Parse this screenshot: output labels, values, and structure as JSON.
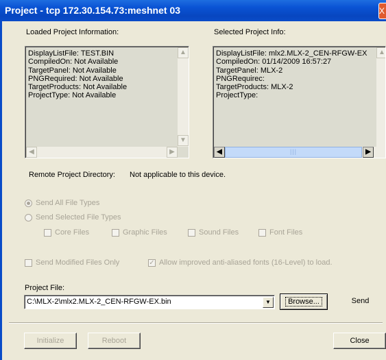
{
  "window": {
    "title": "Project - tcp 172.30.154.73:meshnet 03",
    "close_glyph": "X"
  },
  "loaded": {
    "label": "Loaded Project Information:",
    "lines": [
      "DisplayListFile: TEST.BIN",
      "CompiledOn: Not Available",
      "TargetPanel: Not Available",
      "PNGRequired: Not Available",
      "TargetProducts: Not Available",
      "ProjectType: Not Available"
    ]
  },
  "selected": {
    "label": "Selected Project Info:",
    "lines": [
      "DisplayListFile: mlx2.MLX-2_CEN-RFGW-EX",
      "CompiledOn: 01/14/2009 16:57:27",
      "TargetPanel: MLX-2",
      "PNGRequirec:",
      "TargetProducts: MLX-2",
      "ProjectType:"
    ]
  },
  "remote": {
    "label": "Remote Project Directory:",
    "value": "Not applicable to this device."
  },
  "options": {
    "send_all": "Send All File Types",
    "send_selected": "Send Selected File Types",
    "core": "Core Files",
    "graphic": "Graphic Files",
    "sound": "Sound Files",
    "font": "Font Files",
    "modified_only": "Send Modified Files Only",
    "anti_aliased": "Allow improved anti-aliased fonts (16-Level) to load."
  },
  "project_file": {
    "label": "Project File:",
    "value": "C:\\MLX-2\\mlx2.MLX-2_CEN-RFGW-EX.bin"
  },
  "buttons": {
    "browse": "Browse...",
    "send": "Send",
    "initialize": "Initialize",
    "reboot": "Reboot",
    "close": "Close"
  },
  "icons": {
    "scroll_up": "up-arrow-icon",
    "scroll_down": "down-arrow-icon",
    "scroll_left": "left-arrow-icon",
    "scroll_right": "right-arrow-icon",
    "dropdown": "chevron-down-icon"
  }
}
